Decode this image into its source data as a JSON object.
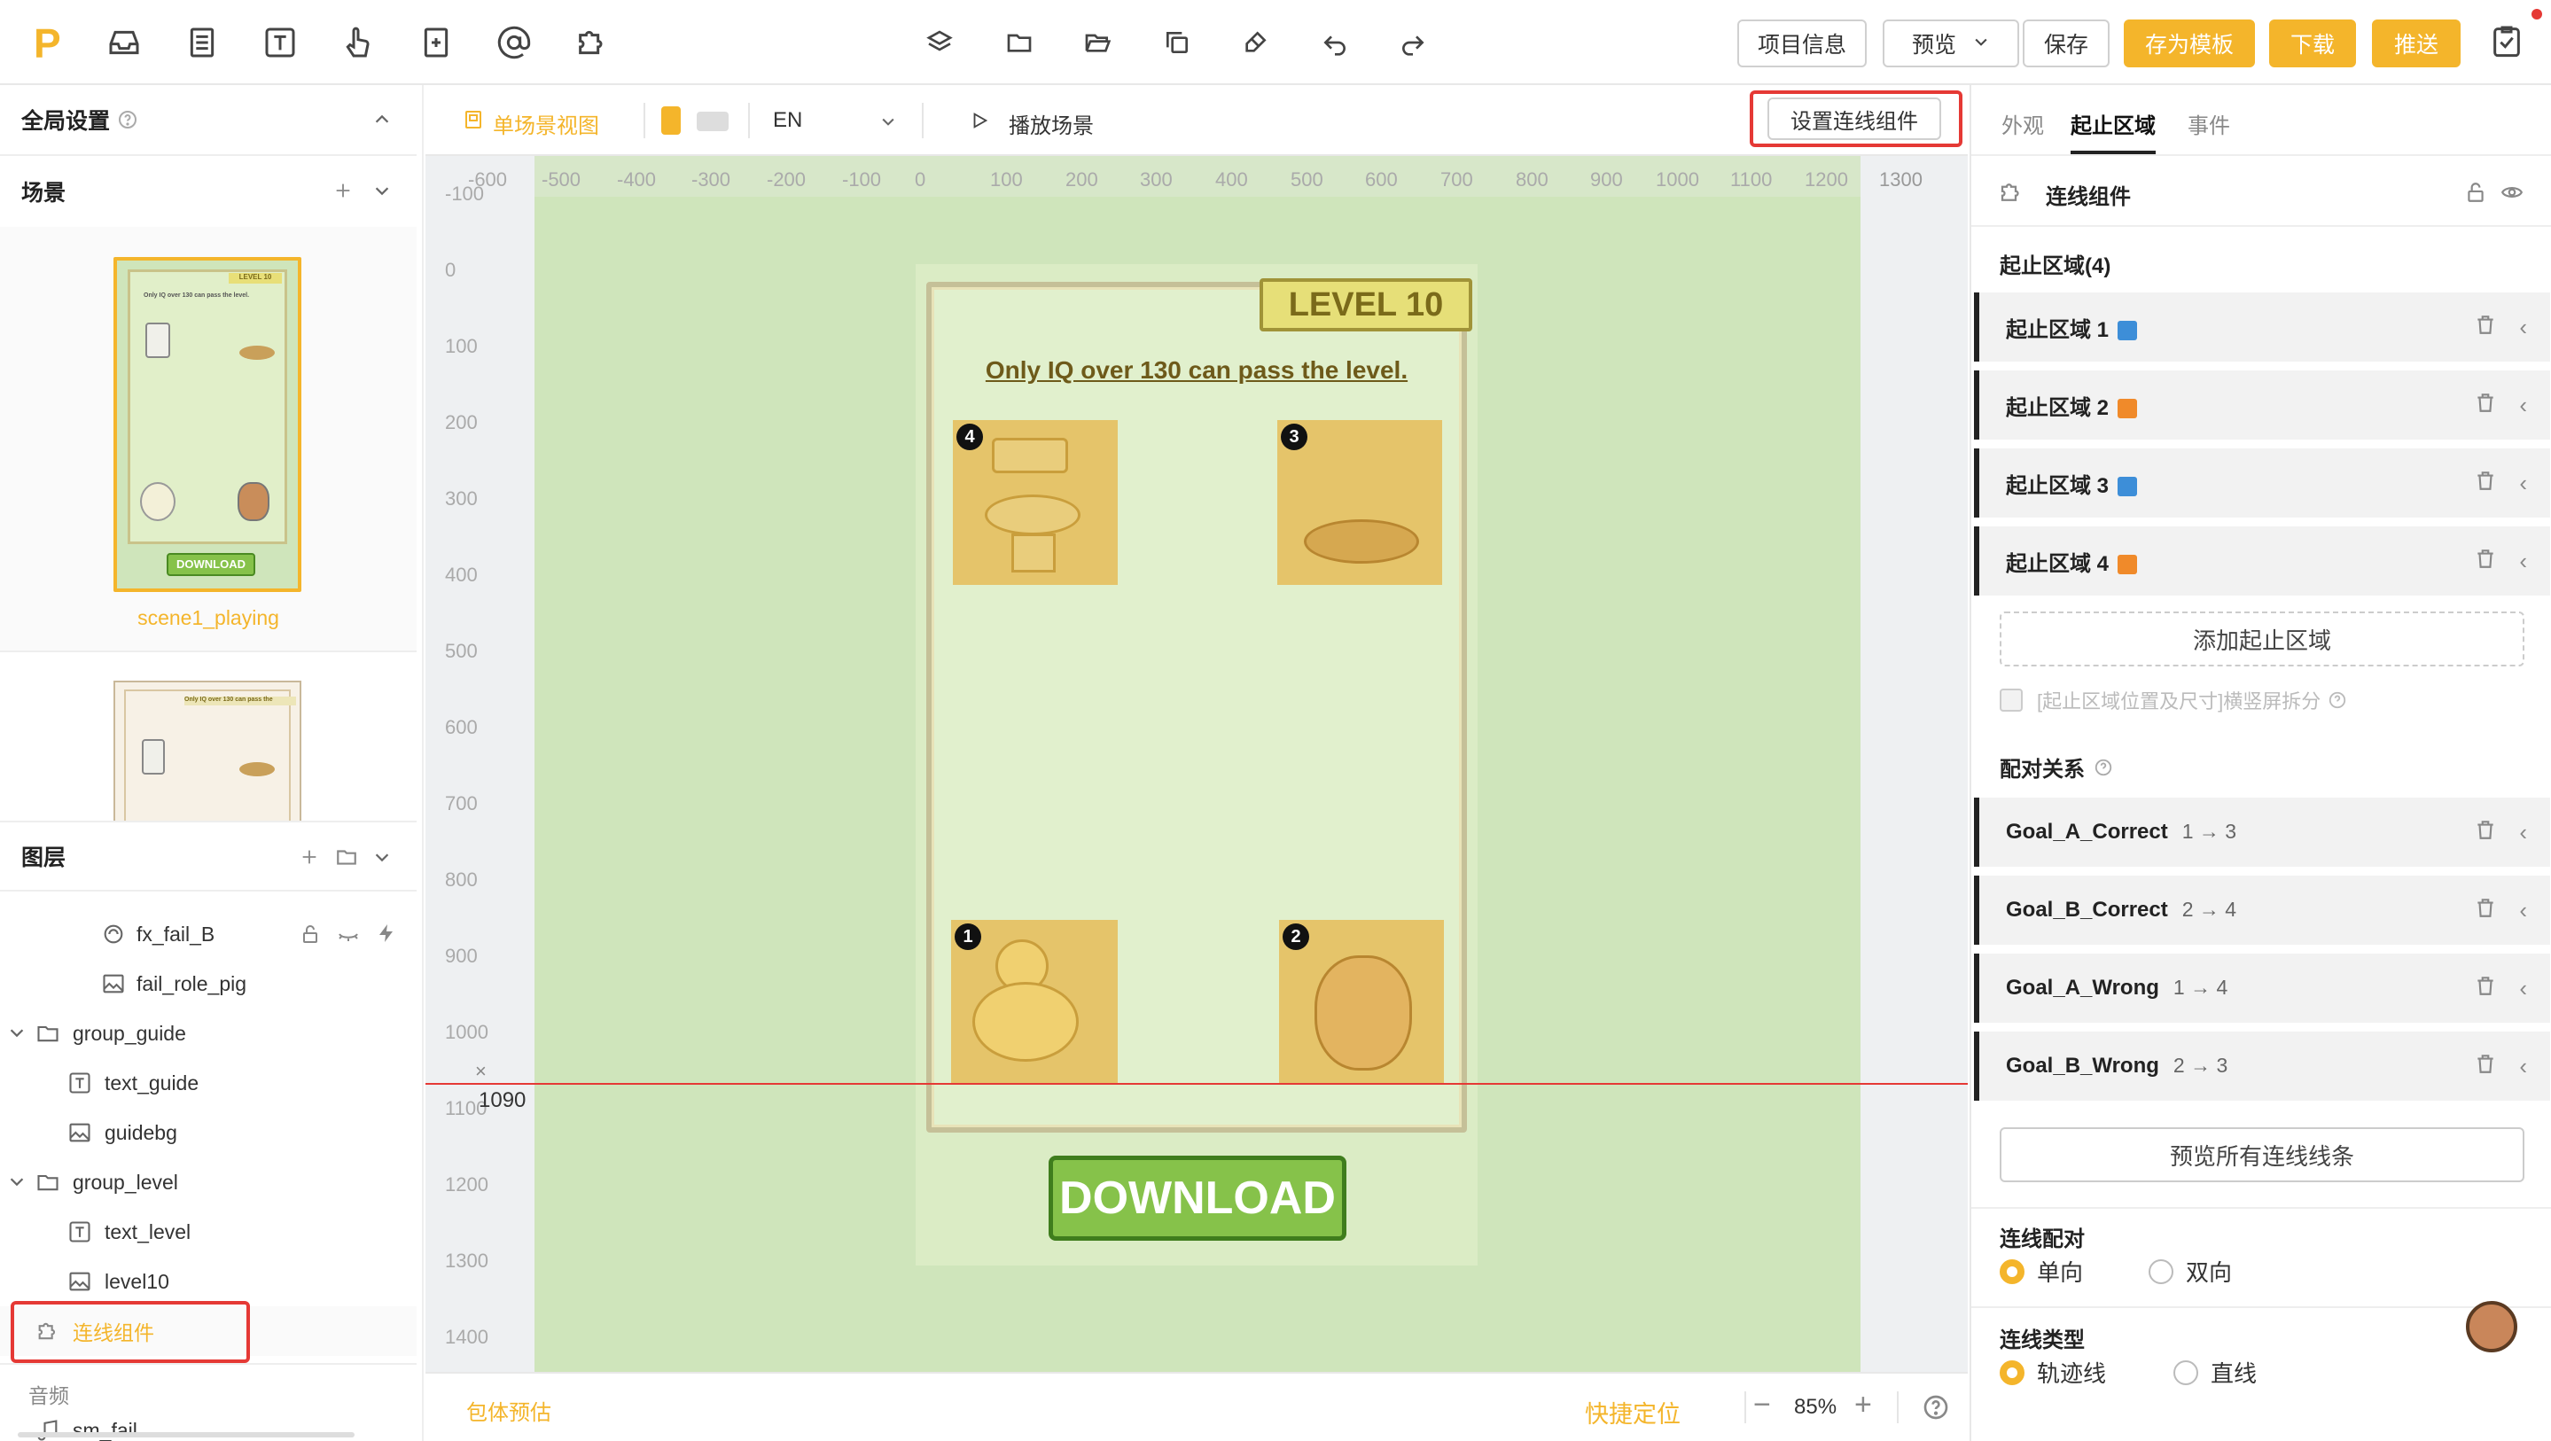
{
  "topbar": {
    "logo": "P",
    "icons": [
      "inbox-icon",
      "document-icon",
      "text-icon",
      "pointer-icon",
      "add-page-icon",
      "at-icon",
      "puzzle-icon"
    ],
    "center_icons": [
      "layers-icon",
      "folder-icon",
      "folder-open-icon",
      "copy-icon",
      "clear-icon",
      "undo-icon",
      "redo-icon"
    ],
    "project_info": "项目信息",
    "preview": "预览",
    "save": "保存",
    "save_template": "存为模板",
    "download": "下载",
    "push": "推送"
  },
  "left": {
    "global_settings": "全局设置",
    "scenes_title": "场景",
    "scene1_name": "scene1_playing",
    "layers_title": "图层",
    "layers": [
      {
        "name": "fx_fail_B",
        "icon": "effect-icon",
        "indent": 2
      },
      {
        "name": "fail_role_pig",
        "icon": "image-icon",
        "indent": 2
      },
      {
        "name": "group_guide",
        "icon": "folder-icon",
        "indent": 1
      },
      {
        "name": "text_guide",
        "icon": "text-icon",
        "indent": 2
      },
      {
        "name": "guidebg",
        "icon": "image-icon",
        "indent": 2
      },
      {
        "name": "group_level",
        "icon": "folder-icon",
        "indent": 1
      },
      {
        "name": "text_level",
        "icon": "text-icon",
        "indent": 2
      },
      {
        "name": "level10",
        "icon": "image-icon",
        "indent": 2
      },
      {
        "name": "连线组件",
        "icon": "puzzle-icon",
        "indent": 1
      }
    ],
    "audio_title": "音频",
    "audio_item": "sm_fail"
  },
  "toolbar": {
    "single_scene": "单场景视图",
    "language": "EN",
    "play_scene": "播放场景",
    "set_component": "设置连线组件"
  },
  "ruler": {
    "top": [
      "-600",
      "-500",
      "-400",
      "-300",
      "-200",
      "-100",
      "0",
      "100",
      "200",
      "300",
      "400",
      "500",
      "600",
      "700",
      "800",
      "900",
      "1000",
      "1100",
      "1200",
      "1300"
    ],
    "left": [
      "-100",
      "0",
      "100",
      "200",
      "300",
      "400",
      "500",
      "600",
      "700",
      "800",
      "900",
      "1000",
      "1100",
      "1200",
      "1300",
      "1400"
    ],
    "guide_value": "1090"
  },
  "game": {
    "level": "LEVEL 10",
    "instruction": "Only IQ over 130 can pass the level.",
    "download": "DOWNLOAD",
    "cells": [
      {
        "num": "4",
        "item": "toilet"
      },
      {
        "num": "3",
        "item": "nest"
      },
      {
        "num": "1",
        "item": "chicken"
      },
      {
        "num": "2",
        "item": "pig"
      }
    ]
  },
  "bottom": {
    "package_estimate": "包体预估",
    "quick_locate": "快捷定位",
    "zoom": "85%"
  },
  "right": {
    "tabs": [
      "外观",
      "起止区域",
      "事件"
    ],
    "active_tab": "起止区域",
    "component_title": "连线组件",
    "zones_title": "起止区域(4)",
    "zones": [
      {
        "name": "起止区域 1",
        "color": "#3d8ed8"
      },
      {
        "name": "起止区域 2",
        "color": "#f08a2a"
      },
      {
        "name": "起止区域 3",
        "color": "#3d8ed8"
      },
      {
        "name": "起止区域 4",
        "color": "#f08a2a"
      }
    ],
    "add_zone": "添加起止区域",
    "split_option": "[起止区域位置及尺寸]横竖屏拆分",
    "pairs_title": "配对关系",
    "pairs": [
      {
        "name": "Goal_A_Correct",
        "rel": "1 → 3"
      },
      {
        "name": "Goal_B_Correct",
        "rel": "2 → 4"
      },
      {
        "name": "Goal_A_Wrong",
        "rel": "1 → 4"
      },
      {
        "name": "Goal_B_Wrong",
        "rel": "2 → 3"
      }
    ],
    "preview_lines": "预览所有连线线条",
    "pairing_title": "连线配对",
    "pairing_options": [
      "单向",
      "双向"
    ],
    "line_type_title": "连线类型",
    "line_type_options": [
      "轨迹线",
      "直线"
    ]
  },
  "colors": {
    "accent": "#f4b52b",
    "highlight": "#e53935"
  }
}
